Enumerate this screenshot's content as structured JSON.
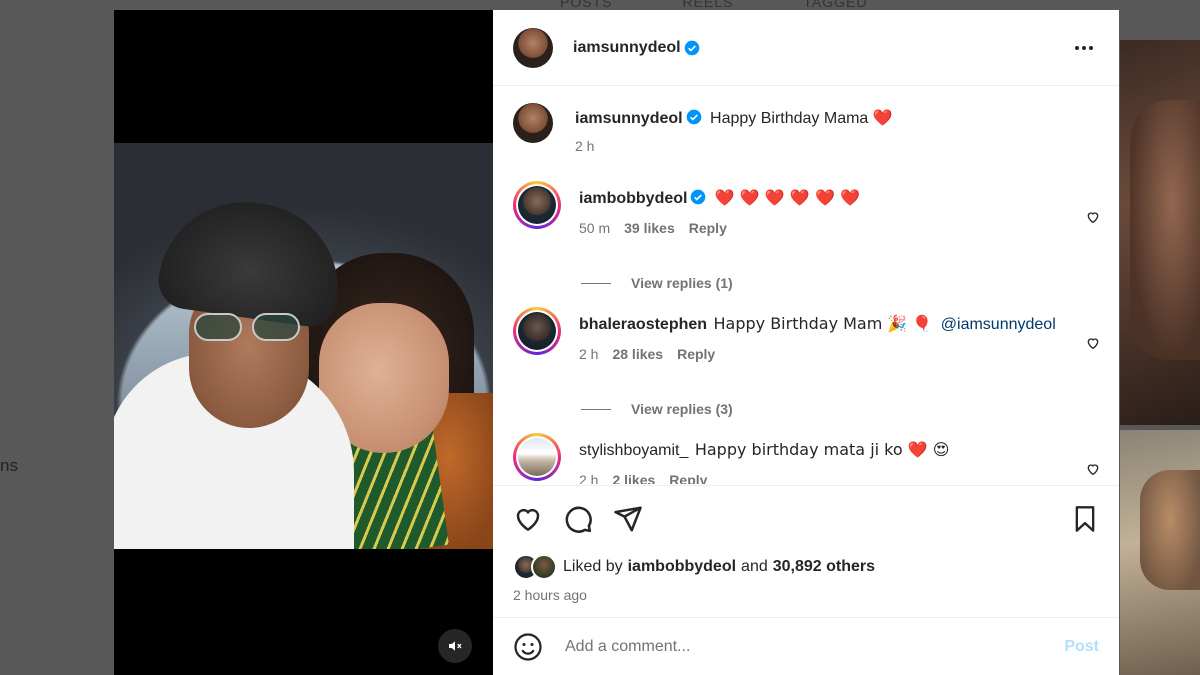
{
  "background": {
    "left_text": "ns",
    "tabs": [
      "POSTS",
      "REELS",
      "TAGGED"
    ]
  },
  "post": {
    "author": "iamsunnydeol",
    "caption": {
      "username": "iamsunnydeol",
      "text": "Happy Birthday Mama",
      "emoji": "❤️",
      "time": "2 h"
    }
  },
  "comments": [
    {
      "username": "iambobbydeol",
      "verified": true,
      "text": "❤️ ❤️ ❤️ ❤️ ❤️ ❤️",
      "time": "50 m",
      "likes": "39 likes",
      "reply": "Reply",
      "view_replies": "View replies (1)"
    },
    {
      "username": "bhaleraostephen",
      "text": "Happy Birthday Mam 🎉 🎈",
      "mention": "@iamsunnydeol",
      "time": "2 h",
      "likes": "28 likes",
      "reply": "Reply",
      "view_replies": "View replies (3)"
    },
    {
      "username": "stylishboyamit_",
      "text": "Happy birthday mata ji ko ❤️ 😍",
      "time": "2 h",
      "likes": "2 likes",
      "reply": "Reply"
    }
  ],
  "likes": {
    "prefix": "Liked by",
    "user": "iambobbydeol",
    "and": "and",
    "others": "30,892 others",
    "time_ago": "2 hours ago"
  },
  "composer": {
    "placeholder": "Add a comment...",
    "post_label": "Post"
  },
  "colors": {
    "verified": "#0095f6",
    "heart": "#ed4956",
    "post_disabled": "#b2dffc"
  },
  "icons": [
    "heart-icon",
    "comment-icon",
    "share-icon",
    "bookmark-icon",
    "more-icon",
    "mute-icon",
    "emoji-icon",
    "verified-icon"
  ]
}
